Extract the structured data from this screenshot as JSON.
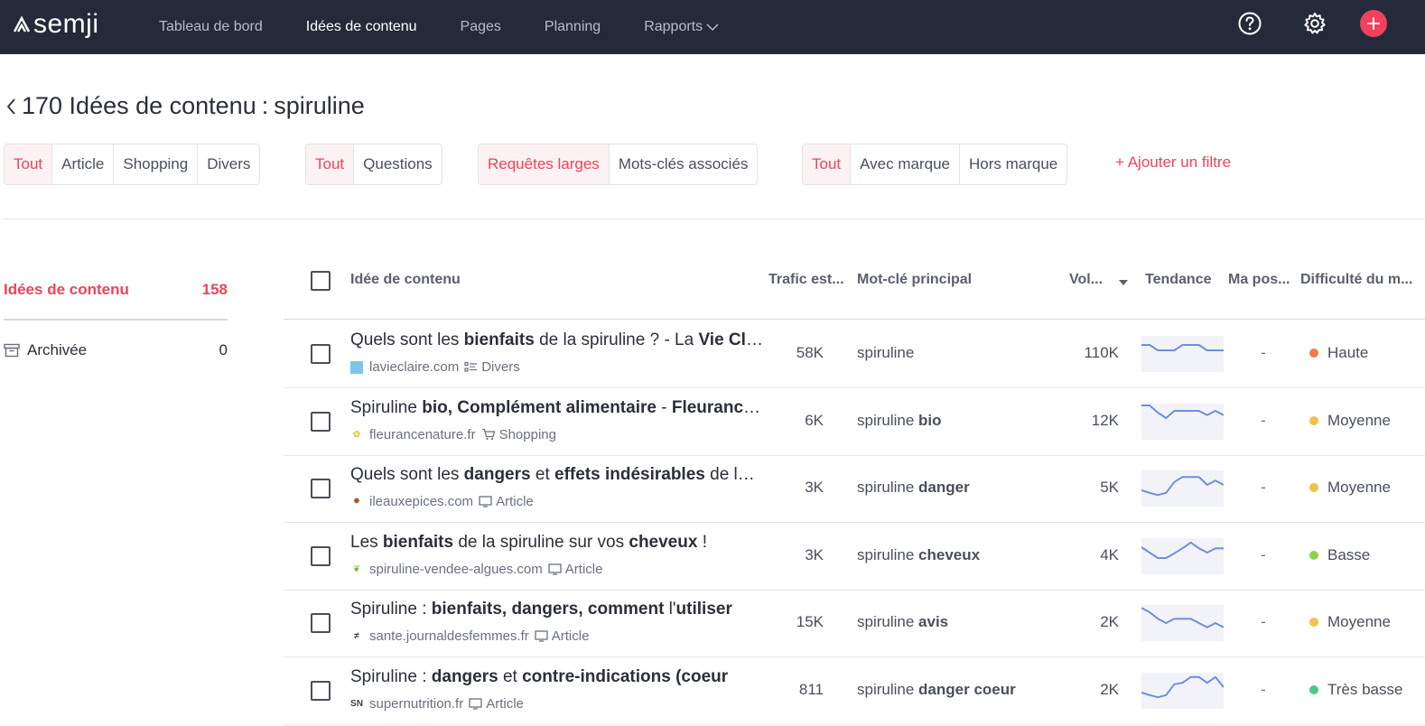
{
  "app": {
    "name": "semji",
    "nav": [
      {
        "label": "Tableau de bord",
        "active": false
      },
      {
        "label": "Idées de contenu",
        "active": true
      },
      {
        "label": "Pages",
        "active": false
      },
      {
        "label": "Planning",
        "active": false
      },
      {
        "label": "Rapports",
        "active": false
      }
    ]
  },
  "page": {
    "title_prefix": "170 Idées de contenu",
    "title_sep": ":",
    "keyword": "spiruline"
  },
  "filters": {
    "type": [
      "Tout",
      "Article",
      "Shopping",
      "Divers"
    ],
    "questions": [
      "Tout",
      "Questions"
    ],
    "queries": [
      "Requêtes larges",
      "Mots-clés associés"
    ],
    "brand": [
      "Tout",
      "Avec marque",
      "Hors marque"
    ],
    "add_filter": "+ Ajouter un filtre"
  },
  "sidebar": {
    "items": [
      {
        "label": "Idées de contenu",
        "count": "158"
      },
      {
        "label": "Archivée",
        "count": "0"
      }
    ]
  },
  "table": {
    "columns": [
      "Idée de contenu",
      "Trafic est...",
      "Mot-clé principal",
      "Vol...",
      "Tendance",
      "Ma pos...",
      "Difficulté du m..."
    ],
    "rows": [
      {
        "title": [
          [
            "",
            "Quels sont les "
          ],
          [
            "b",
            "bienfaits"
          ],
          [
            "",
            " de la spiruline ? - La "
          ],
          [
            "b",
            "Vie Claire"
          ]
        ],
        "domain": "lavieclaire.com",
        "type": "Divers",
        "type_icon": "list-icon",
        "traffic": "58K",
        "kw_base": "spiruline",
        "kw_bold": "",
        "volume": "110K",
        "trend": [
          0.75,
          0.75,
          0.6,
          0.6,
          0.6,
          0.75,
          0.75,
          0.75,
          0.6,
          0.6,
          0.6
        ],
        "position": "-",
        "difficulty": "Haute",
        "difficulty_color": "#f07a47"
      },
      {
        "title": [
          [
            "",
            "Spiruline "
          ],
          [
            "b",
            "bio, Complément alimentaire"
          ],
          [
            "",
            " - "
          ],
          [
            "b",
            "Fleurance Nature"
          ]
        ],
        "domain": "fleurancenature.fr",
        "type": "Shopping",
        "type_icon": "cart-icon",
        "traffic": "6K",
        "kw_base": "spiruline",
        "kw_bold": "bio",
        "volume": "12K",
        "trend": [
          0.95,
          0.95,
          0.75,
          0.6,
          0.8,
          0.8,
          0.8,
          0.8,
          0.68,
          0.8,
          0.68
        ],
        "position": "-",
        "difficulty": "Moyenne",
        "difficulty_color": "#f2c14b"
      },
      {
        "title": [
          [
            "",
            "Quels sont les "
          ],
          [
            "b",
            "dangers"
          ],
          [
            "",
            " et "
          ],
          [
            "b",
            "effets indésirables"
          ],
          [
            "",
            " de la spiruline"
          ]
        ],
        "domain": "ileauxepices.com",
        "type": "Article",
        "type_icon": "monitor-icon",
        "traffic": "3K",
        "kw_base": "spiruline",
        "kw_bold": "danger",
        "volume": "5K",
        "trend": [
          0.45,
          0.38,
          0.32,
          0.38,
          0.68,
          0.82,
          0.82,
          0.82,
          0.6,
          0.72,
          0.6
        ],
        "position": "-",
        "difficulty": "Moyenne",
        "difficulty_color": "#f2c14b"
      },
      {
        "title": [
          [
            "",
            "Les "
          ],
          [
            "b",
            "bienfaits"
          ],
          [
            "",
            " de la spiruline sur vos "
          ],
          [
            "b",
            "cheveux"
          ],
          [
            "",
            " !"
          ]
        ],
        "domain": "spiruline-vendee-algues.com",
        "type": "Article",
        "type_icon": "monitor-icon",
        "traffic": "3K",
        "kw_base": "spiruline",
        "kw_bold": "cheveux",
        "volume": "4K",
        "trend": [
          0.75,
          0.6,
          0.45,
          0.45,
          0.58,
          0.72,
          0.88,
          0.72,
          0.6,
          0.72,
          0.72
        ],
        "position": "-",
        "difficulty": "Basse",
        "difficulty_color": "#8fd14a"
      },
      {
        "title": [
          [
            "",
            "Spiruline : "
          ],
          [
            "b",
            "bienfaits, dangers, comment"
          ],
          [
            "",
            " l'"
          ],
          [
            "b",
            "utiliser"
          ]
        ],
        "domain": "sante.journaldesfemmes.fr",
        "type": "Article",
        "type_icon": "monitor-icon",
        "traffic": "15K",
        "kw_base": "spiruline",
        "kw_bold": "avis",
        "volume": "2K",
        "trend": [
          0.92,
          0.8,
          0.62,
          0.5,
          0.62,
          0.62,
          0.62,
          0.5,
          0.38,
          0.5,
          0.38
        ],
        "position": "-",
        "difficulty": "Moyenne",
        "difficulty_color": "#f2c14b"
      },
      {
        "title": [
          [
            "",
            "Spiruline : "
          ],
          [
            "b",
            "dangers"
          ],
          [
            "",
            " et "
          ],
          [
            "b",
            "contre-indications (coeur"
          ]
        ],
        "domain": "supernutrition.fr",
        "type": "Article",
        "type_icon": "monitor-icon",
        "traffic": "811",
        "kw_base": "spiruline",
        "kw_bold": "danger coeur",
        "volume": "2K",
        "trend": [
          0.45,
          0.38,
          0.32,
          0.38,
          0.68,
          0.72,
          0.88,
          0.88,
          0.72,
          0.88,
          0.6
        ],
        "position": "-",
        "difficulty": "Très basse",
        "difficulty_color": "#4cc68d"
      }
    ]
  },
  "colors": {
    "accent": "#ee4458",
    "nav_bg": "#252a3a",
    "trend_line": "#6f8fd8",
    "trend_bg": "#f1f3f9"
  }
}
